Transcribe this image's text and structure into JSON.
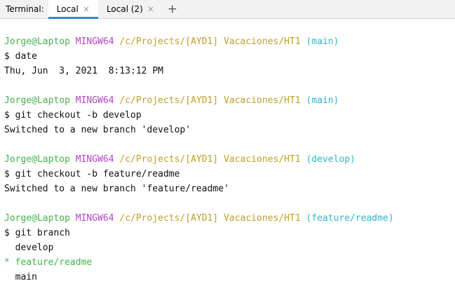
{
  "tabbar": {
    "label": "Terminal:",
    "tabs": [
      {
        "label": "Local",
        "close": "×"
      },
      {
        "label": "Local (2)",
        "close": "×"
      }
    ],
    "add": "+"
  },
  "colors": {
    "user": "#44b24c",
    "mingw": "#b445c2",
    "path": "#bfa024",
    "branch": "#2fb4c7",
    "active_tab_underline": "#4083c9"
  },
  "terminal": {
    "blocks": [
      {
        "user": "Jorge@Laptop",
        "env": "MINGW64",
        "path": "/c/Projects/[AYD1] Vacaciones/HT1",
        "branch": "(main)",
        "command": "$ date",
        "output": [
          "Thu, Jun  3, 2021  8:13:12 PM"
        ]
      },
      {
        "user": "Jorge@Laptop",
        "env": "MINGW64",
        "path": "/c/Projects/[AYD1] Vacaciones/HT1",
        "branch": "(main)",
        "command": "$ git checkout -b develop",
        "output": [
          "Switched to a new branch 'develop'"
        ]
      },
      {
        "user": "Jorge@Laptop",
        "env": "MINGW64",
        "path": "/c/Projects/[AYD1] Vacaciones/HT1",
        "branch": "(develop)",
        "command": "$ git checkout -b feature/readme",
        "output": [
          "Switched to a new branch 'feature/readme'"
        ]
      },
      {
        "user": "Jorge@Laptop",
        "env": "MINGW64",
        "path": "/c/Projects/[AYD1] Vacaciones/HT1",
        "branch": "(feature/readme)",
        "command": "$ git branch",
        "branches": [
          {
            "marker": " ",
            "name": "develop",
            "current": false
          },
          {
            "marker": "*",
            "name": "feature/readme",
            "current": true
          },
          {
            "marker": " ",
            "name": "main",
            "current": false
          }
        ]
      }
    ]
  }
}
